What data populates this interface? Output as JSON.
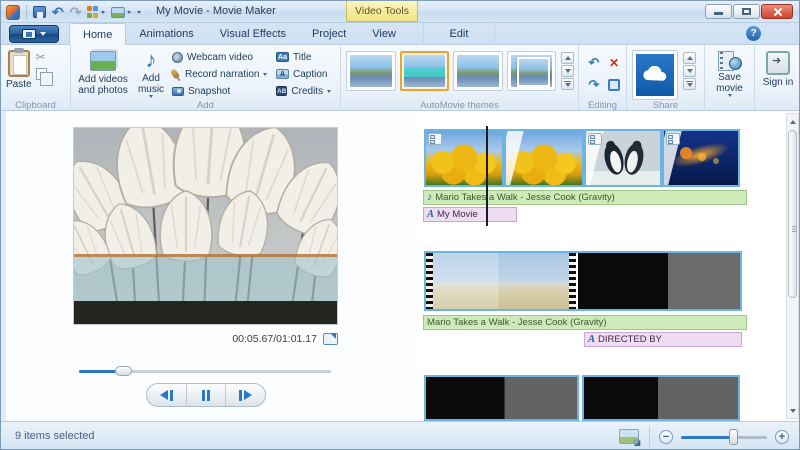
{
  "colors": {
    "selection_blue": "#6cb4e4",
    "track_green": "#cdeab8",
    "track_pink": "#efdef3",
    "video_tools_yellow": "#f0e383",
    "onedrive_blue": "#1766b8",
    "accent_blue": "#2f78c8"
  },
  "window": {
    "title": "My Movie - Movie Maker",
    "video_tools": "Video Tools",
    "help": "?"
  },
  "tabs": [
    "Home",
    "Animations",
    "Visual Effects",
    "Project",
    "View",
    "Edit"
  ],
  "ribbon": {
    "clipboard": {
      "label": "Clipboard",
      "paste": "Paste"
    },
    "add": {
      "label": "Add",
      "add_videos": "Add videos and photos",
      "add_music": "Add music",
      "webcam": "Webcam video",
      "record": "Record narration",
      "snapshot": "Snapshot",
      "title": "Title",
      "caption": "Caption",
      "credits": "Credits"
    },
    "automovie": {
      "label": "AutoMovie themes"
    },
    "editing": {
      "label": "Editing"
    },
    "share": {
      "label": "Share"
    },
    "save_movie": "Save movie",
    "sign_in": "Sign in"
  },
  "preview": {
    "timecode": "00:05.67/01:01.17"
  },
  "storyboard": {
    "music_note": "♪",
    "title_glyph": "A",
    "music_track_1": "Mario Takes a Walk - Jesse Cook (Gravity)",
    "title_track_1": "My Movie",
    "music_track_2": "Mario Takes a Walk - Jesse Cook (Gravity)",
    "title_track_2": "DIRECTED BY"
  },
  "status": {
    "selection": "9 items selected"
  }
}
